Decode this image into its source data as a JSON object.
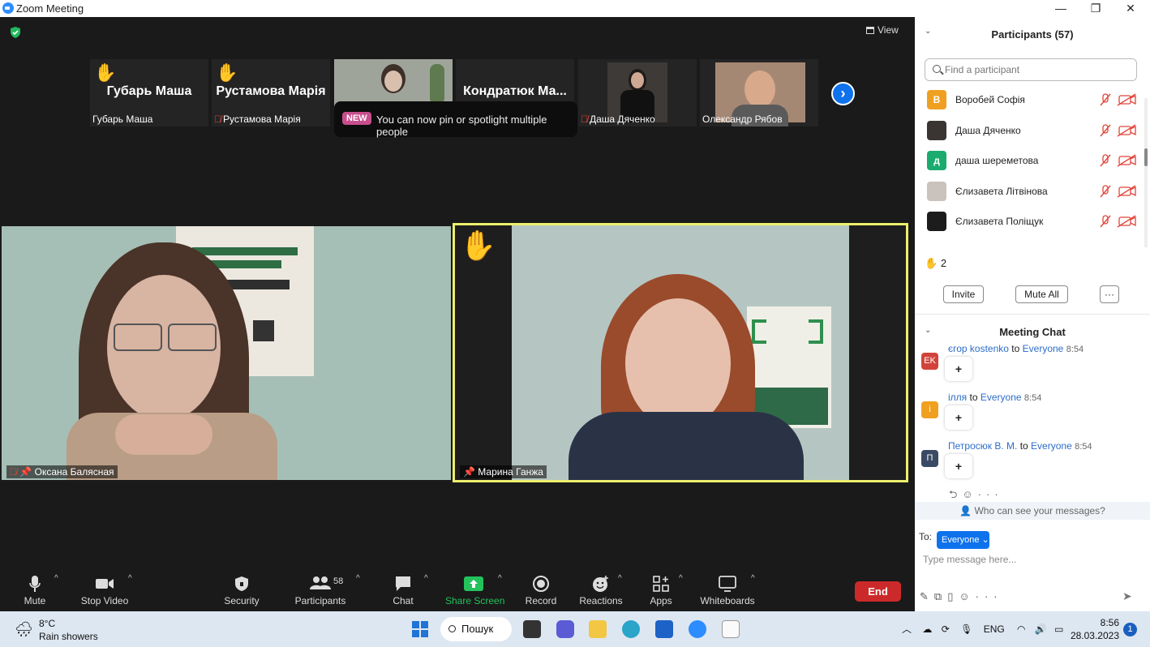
{
  "window": {
    "title": "Zoom Meeting",
    "minimize": "—",
    "maximize": "❐",
    "close": "✕"
  },
  "stage": {
    "view_label": "View"
  },
  "strip": [
    {
      "big": "Губарь Маша",
      "name": "Губарь Маша",
      "hand": true,
      "muted": false
    },
    {
      "big": "Рустамова Марія",
      "name": "Рустамова Марія",
      "hand": true,
      "muted": true
    },
    {
      "big": "",
      "name": "",
      "hand": false,
      "muted": false,
      "photo": "#9fa49b"
    },
    {
      "big": "Кондратюк Ма...",
      "name": "",
      "hand": false,
      "muted": false
    },
    {
      "big": "",
      "name": "Даша Дяченко",
      "hand": false,
      "muted": true,
      "photo": "#3e3a38"
    },
    {
      "big": "",
      "name": "Олександр Рябов",
      "hand": false,
      "muted": false,
      "photo": "#a58874"
    }
  ],
  "toast": {
    "badge": "NEW",
    "text": "You can now pin or spotlight multiple people"
  },
  "videos": [
    {
      "name": "Оксана Балясная",
      "muted": true,
      "pinned": true
    },
    {
      "name": "Марина Ганжа",
      "muted": false,
      "pinned": true,
      "hand": true
    }
  ],
  "toolbar": {
    "mute": "Mute",
    "stop_video": "Stop Video",
    "security": "Security",
    "participants": "Participants",
    "participants_count": "58",
    "chat": "Chat",
    "share": "Share Screen",
    "record": "Record",
    "reactions": "Reactions",
    "apps": "Apps",
    "whiteboards": "Whiteboards",
    "end": "End"
  },
  "panel": {
    "participants_title": "Participants (57)",
    "search_placeholder": "Find a participant",
    "participants": [
      {
        "name": "Воробей Софія",
        "initial": "В",
        "color": "#f0a020"
      },
      {
        "name": "Даша Дяченко",
        "initial": "",
        "color": "#3a3533"
      },
      {
        "name": "даша шереметова",
        "initial": "д",
        "color": "#1bab6f"
      },
      {
        "name": "Єлизавета Літвінова",
        "initial": "",
        "color": "#c9c2bd"
      },
      {
        "name": "Єлизавета Поліщук",
        "initial": "",
        "color": "#1c1c1c"
      }
    ],
    "raised_count": "2",
    "invite": "Invite",
    "mute_all": "Mute All",
    "more": "···",
    "chat_title": "Meeting Chat",
    "messages": [
      {
        "initials": "EK",
        "color": "#d2423a",
        "from": "єгор kostenko",
        "to_word": "to",
        "to": "Everyone",
        "time": "8:54",
        "body": "+"
      },
      {
        "initials": "i",
        "color": "#f0a020",
        "from": "ілля",
        "to_word": "to",
        "to": "Everyone",
        "time": "8:54",
        "body": "+"
      },
      {
        "initials": "П",
        "color": "#3a4a64",
        "from": "Петросюк В. М.",
        "to_word": "to",
        "to": "Everyone",
        "time": "8:54",
        "body": "+"
      }
    ],
    "who_can_see": "Who can see your messages?",
    "to_label": "To:",
    "to_value": "Everyone",
    "input_placeholder": "Type message here..."
  },
  "taskbar": {
    "temp": "8°C",
    "weather": "Rain showers",
    "search": "Пошук",
    "lang": "ENG",
    "time": "8:56",
    "date": "28.03.2023",
    "notifications": "1"
  }
}
